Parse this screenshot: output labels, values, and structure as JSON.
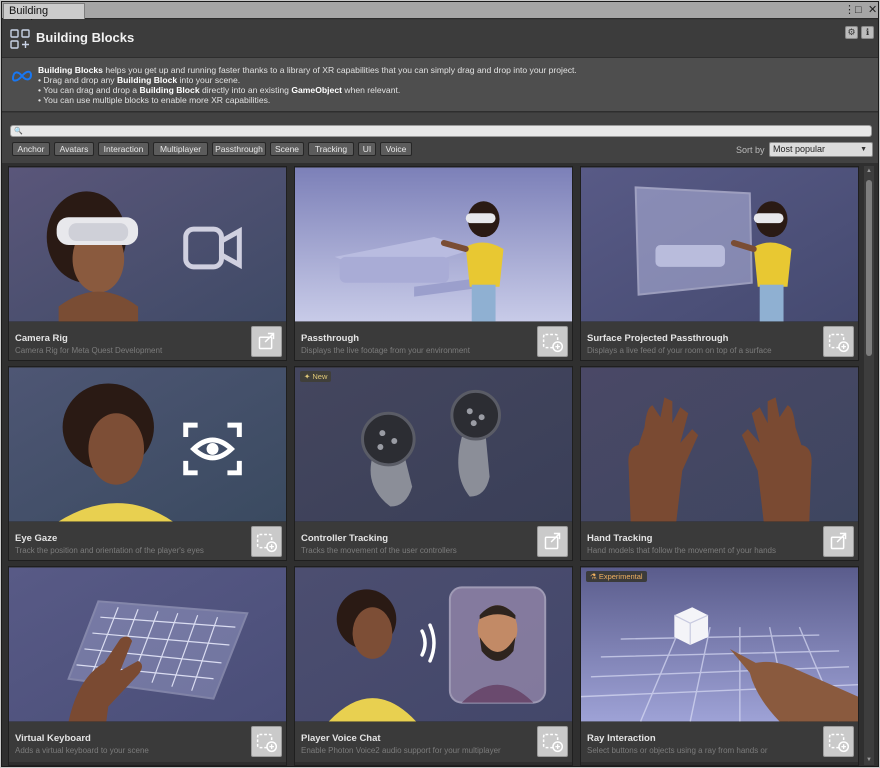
{
  "window": {
    "tab_title": "Building Blocks",
    "menu_glyph": "⋮",
    "max_glyph": "□",
    "close_glyph": "✕"
  },
  "header": {
    "title": "Building Blocks",
    "settings_glyph": "⚙",
    "info_glyph": "ℹ"
  },
  "description": {
    "brand": "Building Blocks",
    "line1_rest": " helps you get up and running faster thanks to a library of XR capabilities that you can simply drag and drop into your project.",
    "bullet1_pre": "• Drag and drop any ",
    "bullet1_bold": "Building Block",
    "bullet1_post": " into your scene.",
    "bullet2_pre": "• You can drag and drop a ",
    "bullet2_bold": "Building Block",
    "bullet2_mid": " directly into an existing ",
    "bullet2_bold2": "GameObject",
    "bullet2_post": " when relevant.",
    "bullet3": "• You can use multiple blocks to enable more XR capabilities."
  },
  "search": {
    "placeholder": "",
    "icon": "search-icon",
    "glyph": "🔍"
  },
  "filters": [
    "Anchor",
    "Avatars",
    "Interaction",
    "Multiplayer",
    "Passthrough",
    "Scene",
    "Tracking",
    "UI",
    "Voice"
  ],
  "sort": {
    "label": "Sort by",
    "selected": "Most popular",
    "caret": "▼"
  },
  "scroll": {
    "up": "▲",
    "down": "▼"
  },
  "cards": [
    {
      "title": "Camera Rig",
      "subtitle": "Camera Rig for Meta Quest Development",
      "badge": "",
      "added": true
    },
    {
      "title": "Passthrough",
      "subtitle": "Displays the live footage from your environment",
      "badge": "",
      "added": false
    },
    {
      "title": "Surface Projected Passthrough",
      "subtitle": "Displays a live feed of your room on top of a surface",
      "badge": "",
      "added": false
    },
    {
      "title": "Eye Gaze",
      "subtitle": "Track the position and orientation of the player's eyes",
      "badge": "",
      "added": false
    },
    {
      "title": "Controller Tracking",
      "subtitle": "Tracks the movement of the user controllers",
      "badge": "New",
      "added": true
    },
    {
      "title": "Hand Tracking",
      "subtitle": "Hand models that follow the movement of your hands",
      "badge": "",
      "added": true
    },
    {
      "title": "Virtual Keyboard",
      "subtitle": "Adds a virtual keyboard to your scene",
      "badge": "",
      "added": false
    },
    {
      "title": "Player Voice Chat",
      "subtitle": "Enable Photon Voice2 audio support for your multiplayer",
      "badge": "",
      "added": false
    },
    {
      "title": "Ray Interaction",
      "subtitle": "Select buttons or objects using a ray from hands or",
      "badge": "Experimental",
      "added": false
    }
  ],
  "colors": {
    "accent_meta": "#1877f2",
    "new_badge": "#e0c878",
    "experimental_badge": "#f0b060"
  }
}
